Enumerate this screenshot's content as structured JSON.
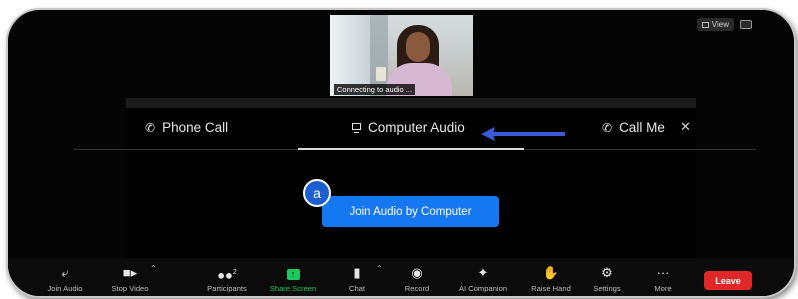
{
  "view": {
    "label": "View"
  },
  "video": {
    "status_caption": "Connecting to audio ..."
  },
  "dialog": {
    "tabs": [
      {
        "label": "Phone Call",
        "icon": "phone-icon"
      },
      {
        "label": "Computer Audio",
        "icon": "monitor-icon"
      },
      {
        "label": "Call Me",
        "icon": "phone-icon"
      }
    ],
    "active_tab": "Computer Audio",
    "join_button": "Join Audio by Computer",
    "badge": "a"
  },
  "toolbar": {
    "items": [
      {
        "label": "Join Audio",
        "icon": "headphone-icon"
      },
      {
        "label": "Stop Video",
        "icon": "video-camera-icon"
      },
      {
        "label": "Participants",
        "icon": "people-icon",
        "count": "2"
      },
      {
        "label": "Share Screen",
        "icon": "share-screen-icon"
      },
      {
        "label": "Chat",
        "icon": "chat-icon"
      },
      {
        "label": "Record",
        "icon": "record-icon"
      },
      {
        "label": "AI Companion",
        "icon": "sparkle-icon"
      },
      {
        "label": "Raise Hand",
        "icon": "hand-icon"
      },
      {
        "label": "Settings",
        "icon": "gear-icon"
      },
      {
        "label": "More",
        "icon": "more-icon"
      }
    ],
    "leave": "Leave"
  },
  "colors": {
    "accent_blue": "#1677f2",
    "share_green": "#1bc95a",
    "leave_red": "#e02828",
    "arrow_blue": "#3a5ad8"
  }
}
